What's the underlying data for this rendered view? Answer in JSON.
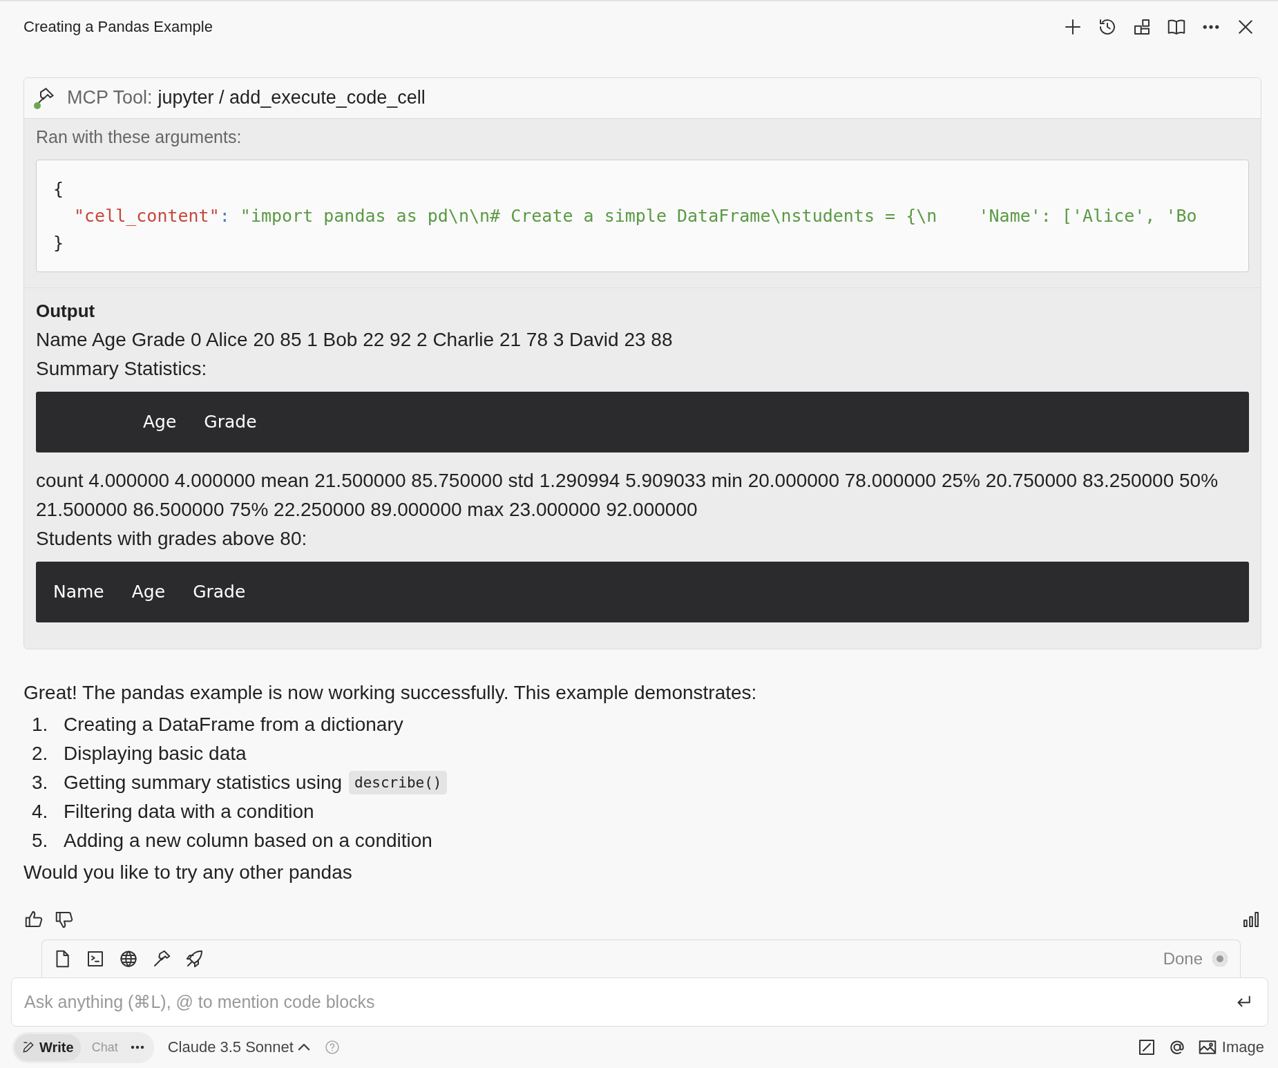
{
  "header": {
    "title": "Creating a Pandas Example"
  },
  "tool_call": {
    "label": "MCP Tool:",
    "name": "jupyter / add_execute_code_cell",
    "color": "#6aa84f",
    "arguments_label": "Ran with these arguments:",
    "arguments": {
      "open": "{",
      "key": "\"cell_content\"",
      "colon": ":",
      "value": "\"import pandas as pd\\n\\n# Create a simple DataFrame\\nstudents = {\\n    'Name': ['Alice', 'Bo",
      "close": "}"
    },
    "output": {
      "heading": "Output",
      "blocks": [
        {
          "kind": "text",
          "text": "Name Age Grade 0 Alice 20 85 1 Bob 22 92 2 Charlie 21 78 3 David 23 88"
        },
        {
          "kind": "text",
          "text": "Summary Statistics:"
        },
        {
          "kind": "table",
          "columns": [
            "",
            "Age",
            "Grade"
          ]
        },
        {
          "kind": "text",
          "text": "count 4.000000 4.000000 mean 21.500000 85.750000 std 1.290994 5.909033 min 20.000000 78.000000 25% 20.750000 83.250000 50% 21.500000 86.500000 75% 22.250000 89.000000 max 23.000000 92.000000"
        },
        {
          "kind": "text",
          "text": "Students with grades above 80:"
        },
        {
          "kind": "table",
          "columns": [
            "Name",
            "Age",
            "Grade"
          ]
        }
      ]
    }
  },
  "message": {
    "intro": "Great! The pandas example is now working successfully. This example demonstrates:",
    "items": [
      {
        "number": "1.",
        "text": "Creating a DataFrame from a dictionary"
      },
      {
        "number": "2.",
        "text": "Displaying basic data"
      },
      {
        "number": "3.",
        "text": "Getting summary statistics using",
        "code": "describe()"
      },
      {
        "number": "4.",
        "text": "Filtering data with a condition"
      },
      {
        "number": "5.",
        "text": "Adding a new column based on a condition"
      }
    ],
    "outro": "Would you like to try any other pandas"
  },
  "status": {
    "label": "Done"
  },
  "composer": {
    "placeholder": "Ask anything (⌘L), @ to mention code blocks"
  },
  "modes": [
    {
      "label": "Write",
      "selected": true
    },
    {
      "label": "Chat",
      "selected": false
    }
  ],
  "model": {
    "label": "Claude 3.5 Sonnet"
  },
  "image_button": {
    "label": "Image"
  }
}
